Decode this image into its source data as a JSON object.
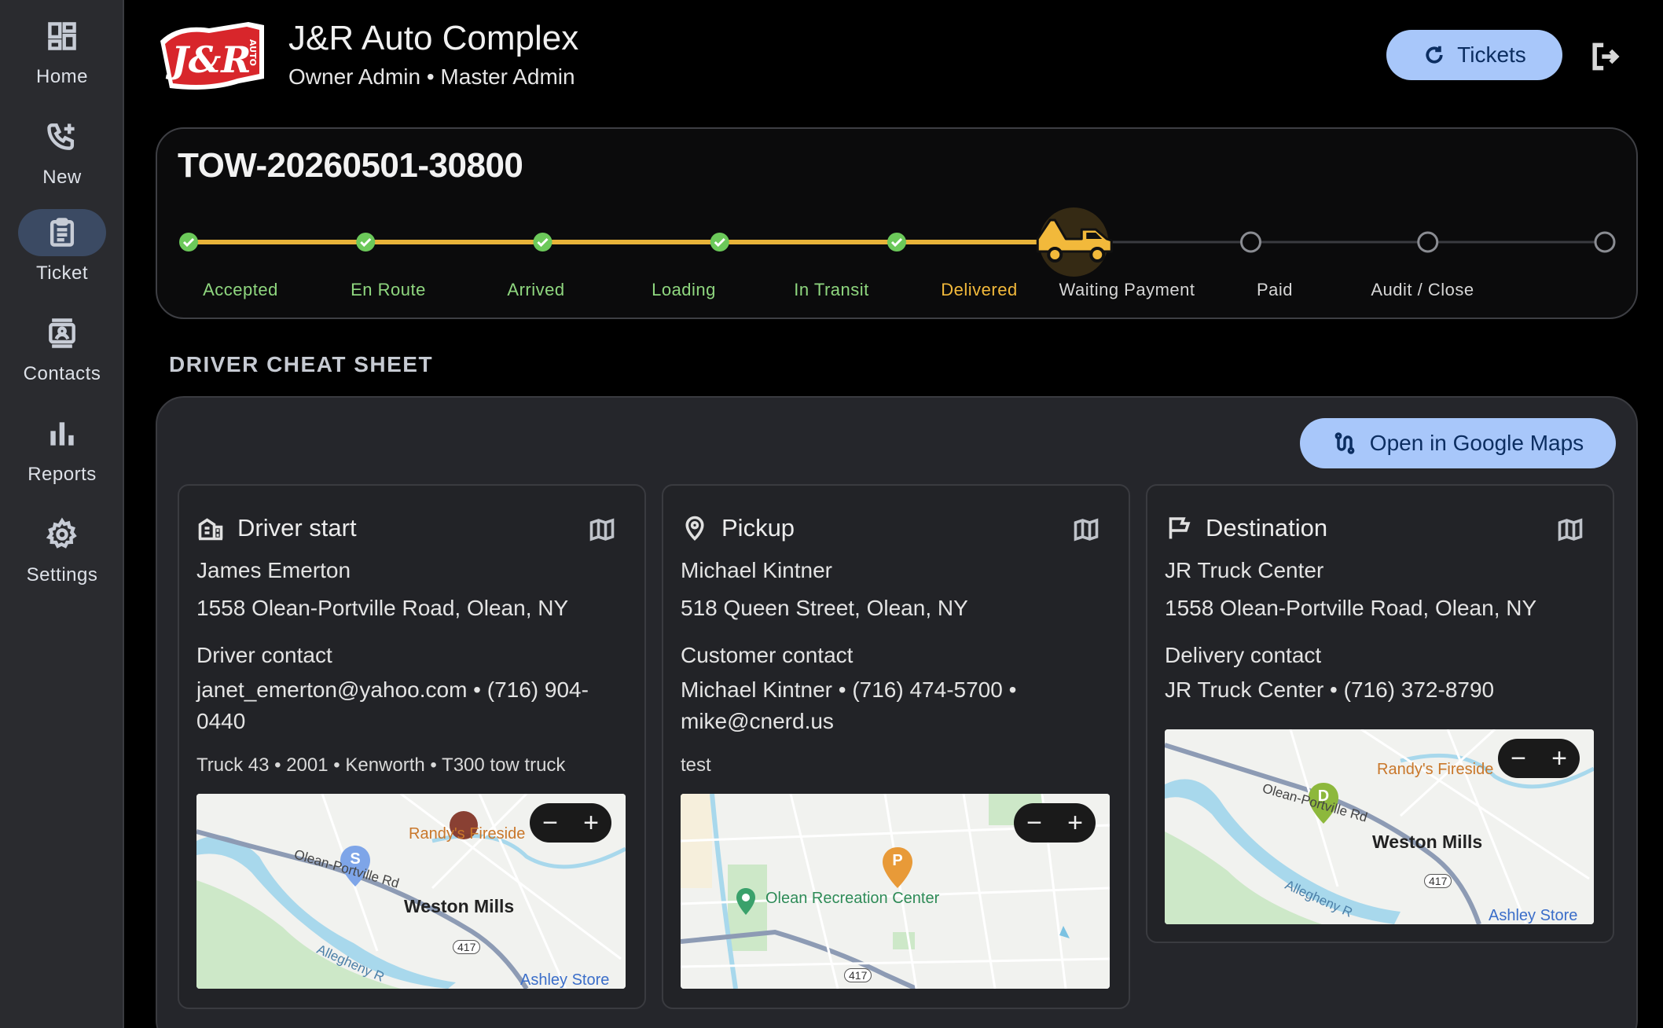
{
  "nav": [
    {
      "label": "Home",
      "icon": "dashboard-icon"
    },
    {
      "label": "New",
      "icon": "phone-add-icon"
    },
    {
      "label": "Ticket",
      "icon": "clipboard-icon"
    },
    {
      "label": "Contacts",
      "icon": "contacts-icon"
    },
    {
      "label": "Reports",
      "icon": "bar-chart-icon"
    },
    {
      "label": "Settings",
      "icon": "gear-icon"
    }
  ],
  "header": {
    "logo_text": "J&R AUTO",
    "title": "J&R Auto Complex",
    "subtitle": "Owner Admin • Master Admin",
    "tickets_label": "Tickets"
  },
  "ticket": {
    "id": "TOW-20260501-30800",
    "current_step": 6,
    "steps": [
      {
        "label": "Accepted",
        "state": "done"
      },
      {
        "label": "En Route",
        "state": "done"
      },
      {
        "label": "Arrived",
        "state": "done"
      },
      {
        "label": "Loading",
        "state": "done"
      },
      {
        "label": "In Transit",
        "state": "done"
      },
      {
        "label": "Delivered",
        "state": "current"
      },
      {
        "label": "Waiting Payment",
        "state": "todo"
      },
      {
        "label": "Paid",
        "state": "todo"
      },
      {
        "label": "Audit / Close",
        "state": "todo"
      }
    ]
  },
  "cheat_sheet": {
    "title": "DRIVER CHEAT SHEET",
    "maps_button": "Open in Google Maps",
    "driver_start": {
      "title": "Driver start",
      "name": "James Emerton",
      "address": "1558 Olean-Portville Road, Olean, NY",
      "contact_label": "Driver contact",
      "contact": "janet_emerton@yahoo.com • (716) 904-0440",
      "note": "Truck 43 • 2001 • Kenworth • T300 tow truck",
      "map": {
        "pin": "S",
        "labels": [
          "Randy's Fireside",
          "Olean-Portville Rd",
          "Weston Mills",
          "417",
          "Allegheny R",
          "Ashley Store"
        ]
      }
    },
    "pickup": {
      "title": "Pickup",
      "name": "Michael Kintner",
      "address": "518 Queen Street, Olean, NY",
      "contact_label": "Customer contact",
      "contact": "Michael Kintner • (716) 474-5700 • mike@cnerd.us",
      "note": "test",
      "map": {
        "pin": "P",
        "labels": [
          "Olean Recreation Center",
          "417"
        ]
      }
    },
    "destination": {
      "title": "Destination",
      "name": "JR Truck Center",
      "address": "1558 Olean-Portville Road, Olean, NY",
      "contact_label": "Delivery contact",
      "contact": "JR Truck Center • (716) 372-8790",
      "map": {
        "pin": "D",
        "labels": [
          "Randy's Fireside",
          "Olean-Portville Rd",
          "Weston Mills",
          "417",
          "Allegheny R",
          "Ashley Store"
        ]
      }
    }
  },
  "colors": {
    "accent": "#a8c7fa",
    "done": "#8fd77f",
    "current": "#f2b93b",
    "progress": "#e8b339"
  }
}
